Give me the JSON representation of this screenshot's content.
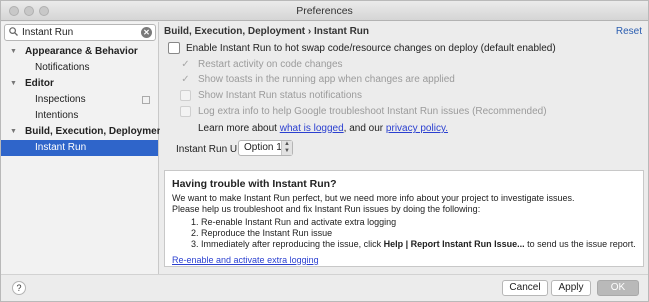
{
  "window": {
    "title": "Preferences"
  },
  "sidebar": {
    "search_value": "Instant Run",
    "items": [
      {
        "label": "Appearance & Behavior"
      },
      {
        "label": "Notifications"
      },
      {
        "label": "Editor"
      },
      {
        "label": "Inspections"
      },
      {
        "label": "Intentions"
      },
      {
        "label": "Build, Execution, Deployment"
      },
      {
        "label": "Instant Run"
      }
    ]
  },
  "main": {
    "breadcrumb": "Build, Execution, Deployment › Instant Run",
    "reset_label": "Reset",
    "options": {
      "enable": {
        "label": "Enable Instant Run to hot swap code/resource changes on deploy (default enabled)",
        "checked": false
      },
      "restart": {
        "label": "Restart activity on code changes",
        "checked": true
      },
      "toasts": {
        "label": "Show toasts in the running app when changes are applied",
        "checked": true
      },
      "status": {
        "label": "Show Instant Run status notifications",
        "checked": false
      },
      "log": {
        "label": "Log extra info to help Google troubleshoot Instant Run issues (Recommended)",
        "checked": false
      }
    },
    "learn_more": {
      "prefix": "Learn more about ",
      "link1": "what is logged",
      "middle": ", and our ",
      "link2": "privacy policy."
    },
    "instant_run_ui": {
      "label": "Instant Run UI",
      "value": "Option 1"
    },
    "trouble": {
      "title": "Having trouble with Instant Run?",
      "line1": "We want to make Instant Run perfect, but we need more info about your project to investigate issues.",
      "line2": "Please help us troubleshoot and fix Instant Run issues by doing the following:",
      "step1": "1. Re-enable Instant Run and activate extra logging",
      "step2": "2. Reproduce the Instant Run issue",
      "step3_prefix": "3. Immediately after reproducing the issue, click ",
      "step3_bold": "Help | Report Instant Run Issue...",
      "step3_suffix": " to send us the issue report.",
      "link": "Re-enable and activate extra logging"
    }
  },
  "footer": {
    "help_label": "?",
    "cancel_label": "Cancel",
    "apply_label": "Apply",
    "ok_label": "OK"
  },
  "icons": {
    "checkmark": "✓",
    "arrow_expanded": "▼",
    "search": "⌕",
    "clear": "✕",
    "spinner": "▲▼"
  }
}
